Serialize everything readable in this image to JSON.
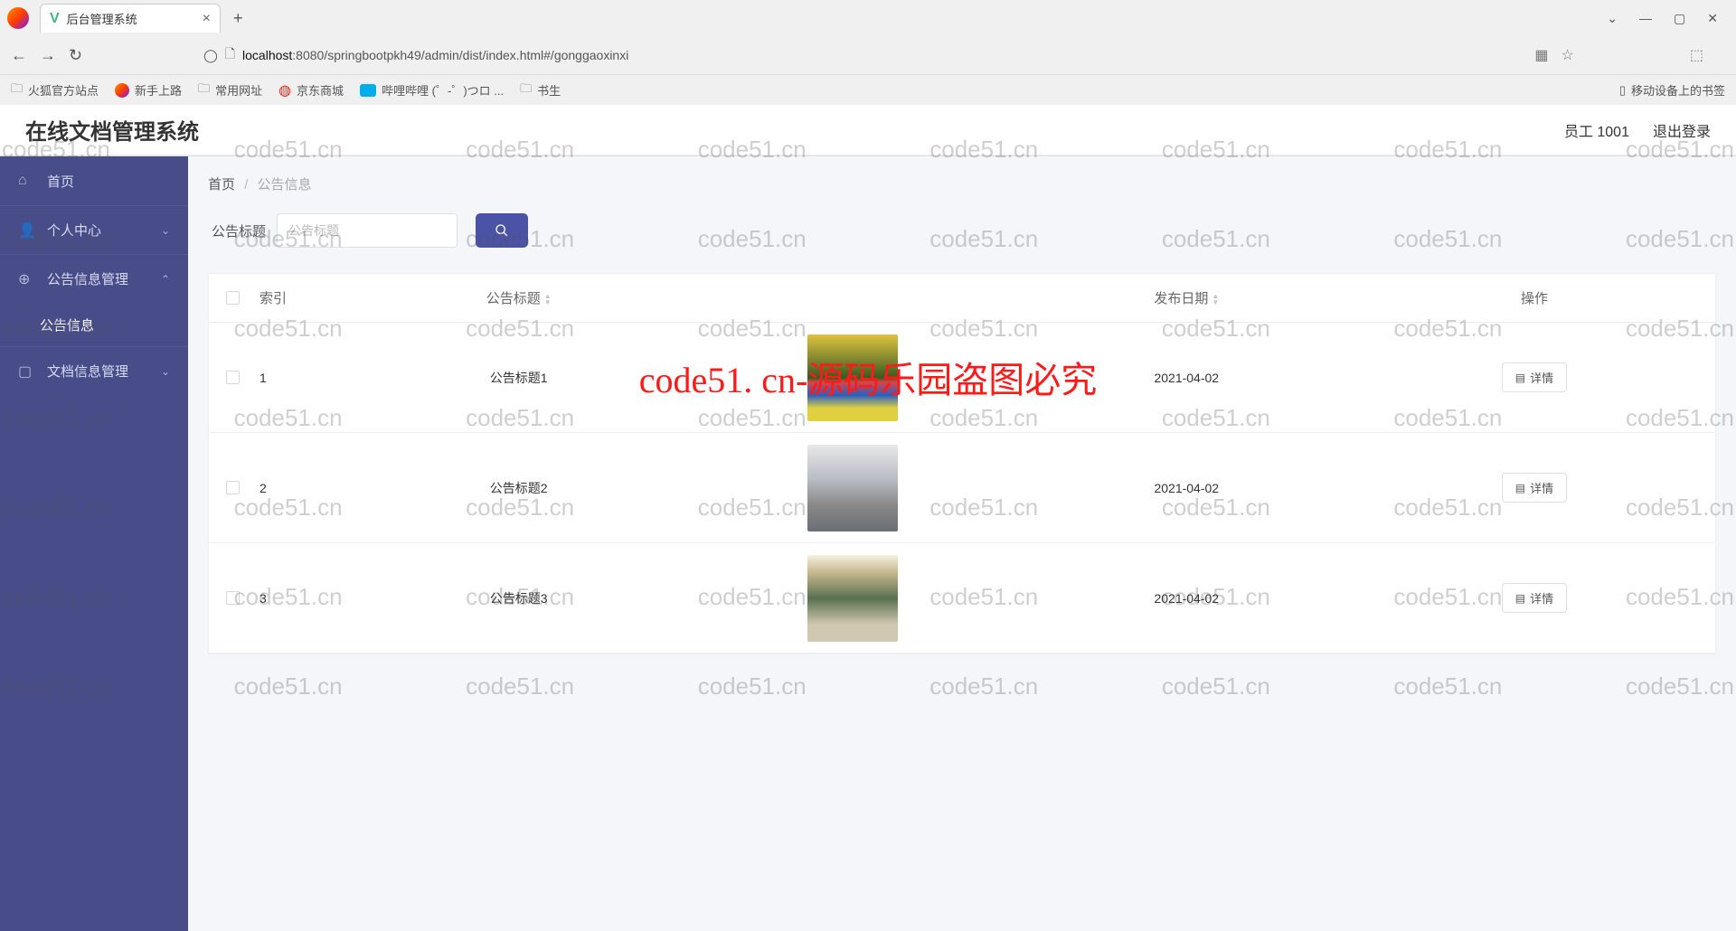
{
  "browser": {
    "tab_title": "后台管理系统",
    "url_prefix": "localhost",
    "url_rest": ":8080/springbootpkh49/admin/dist/index.html#/gonggaoxinxi",
    "bookmarks": [
      "火狐官方站点",
      "新手上路",
      "常用网址",
      "京东商城",
      "哔哩哔哩 (゜-゜)つロ ...",
      "书生"
    ],
    "mobile_bm": "移动设备上的书签"
  },
  "watermark": "code51.cn",
  "big_watermark": "code51. cn-源码乐园盗图必究",
  "header": {
    "app_title": "在线文档管理系统",
    "user": "员工 1001",
    "logout": "退出登录"
  },
  "sidebar": {
    "items": [
      {
        "label": "首页",
        "icon": "home"
      },
      {
        "label": "个人中心",
        "icon": "user",
        "arrow": "down"
      },
      {
        "label": "公告信息管理",
        "icon": "globe",
        "arrow": "up",
        "expanded": true,
        "sub": "公告信息"
      },
      {
        "label": "文档信息管理",
        "icon": "doc",
        "arrow": "down"
      }
    ]
  },
  "breadcrumb": {
    "home": "首页",
    "current": "公告信息"
  },
  "filter": {
    "label": "公告标题",
    "placeholder": "公告标题"
  },
  "table": {
    "headers": {
      "index": "索引",
      "title": "公告标题",
      "image": "",
      "date": "发布日期",
      "op": "操作"
    },
    "op_label": "详情",
    "rows": [
      {
        "idx": "1",
        "title": "公告标题1",
        "date": "2021-04-02"
      },
      {
        "idx": "2",
        "title": "公告标题2",
        "date": "2021-04-02"
      },
      {
        "idx": "3",
        "title": "公告标题3",
        "date": "2021-04-02"
      }
    ]
  }
}
